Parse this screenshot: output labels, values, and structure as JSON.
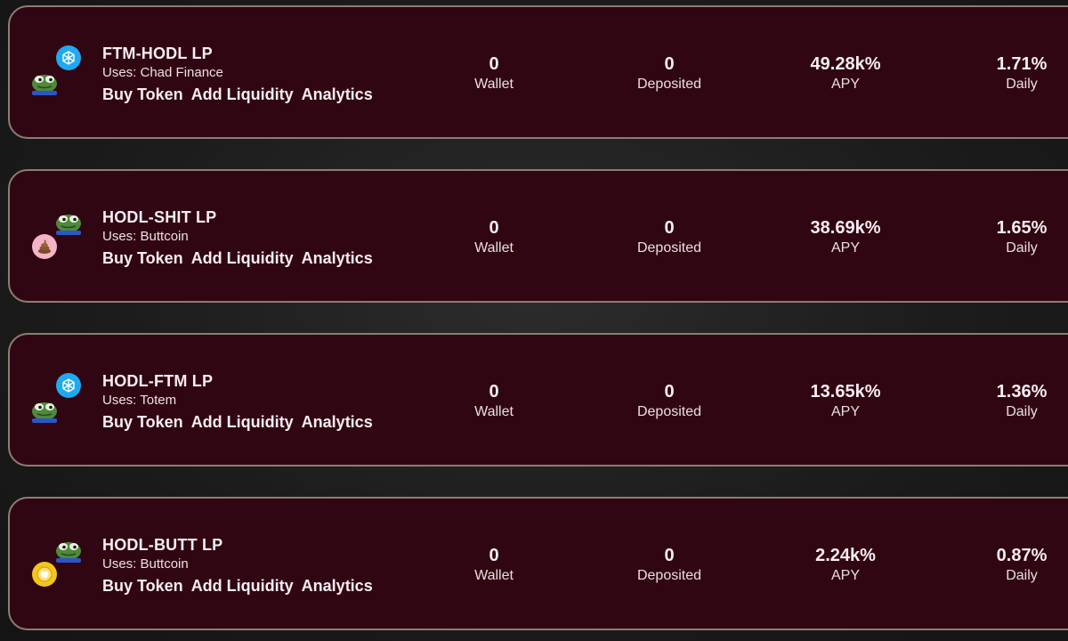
{
  "pools": [
    {
      "name": "FTM-HODL LP",
      "uses": "Uses: Chad Finance",
      "top_token_icon": "fantom-token-icon",
      "bottom_token_icon": "pepe-frog-icon",
      "links": {
        "buy": "Buy Token",
        "add_liquidity": "Add Liquidity",
        "analytics": "Analytics"
      },
      "stats": {
        "wallet": "0",
        "wallet_label": "Wallet",
        "deposited": "0",
        "deposited_label": "Deposited",
        "apy": "49.28k%",
        "apy_label": "APY",
        "daily": "1.71%",
        "daily_label": "Daily"
      }
    },
    {
      "name": "HODL-SHIT LP",
      "uses": "Uses: Buttcoin",
      "top_token_icon": "pepe-frog-icon",
      "bottom_token_icon": "poop-token-icon",
      "links": {
        "buy": "Buy Token",
        "add_liquidity": "Add Liquidity",
        "analytics": "Analytics"
      },
      "stats": {
        "wallet": "0",
        "wallet_label": "Wallet",
        "deposited": "0",
        "deposited_label": "Deposited",
        "apy": "38.69k%",
        "apy_label": "APY",
        "daily": "1.65%",
        "daily_label": "Daily"
      }
    },
    {
      "name": "HODL-FTM LP",
      "uses": "Uses: Totem",
      "top_token_icon": "fantom-token-icon",
      "bottom_token_icon": "pepe-frog-icon",
      "links": {
        "buy": "Buy Token",
        "add_liquidity": "Add Liquidity",
        "analytics": "Analytics"
      },
      "stats": {
        "wallet": "0",
        "wallet_label": "Wallet",
        "deposited": "0",
        "deposited_label": "Deposited",
        "apy": "13.65k%",
        "apy_label": "APY",
        "daily": "1.36%",
        "daily_label": "Daily"
      }
    },
    {
      "name": "HODL-BUTT LP",
      "uses": "Uses: Buttcoin",
      "top_token_icon": "pepe-frog-icon",
      "bottom_token_icon": "buttcoin-token-icon",
      "links": {
        "buy": "Buy Token",
        "add_liquidity": "Add Liquidity",
        "analytics": "Analytics"
      },
      "stats": {
        "wallet": "0",
        "wallet_label": "Wallet",
        "deposited": "0",
        "deposited_label": "Deposited",
        "apy": "2.24k%",
        "apy_label": "APY",
        "daily": "0.87%",
        "daily_label": "Daily"
      }
    }
  ],
  "colors": {
    "card_background": "#310613",
    "card_border": "#8c7d72",
    "page_background": "#1c1c1c",
    "fantom_blue": "#1fa9f0",
    "frog_green": "#4d8a3a"
  }
}
